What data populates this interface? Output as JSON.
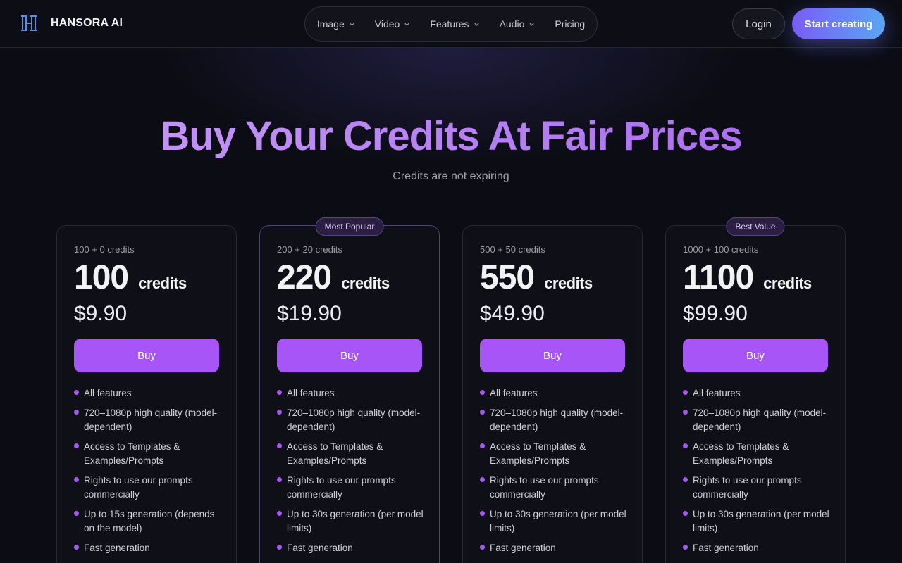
{
  "header": {
    "brand": "HANSORA AI",
    "nav": [
      {
        "label": "Image",
        "dropdown": true
      },
      {
        "label": "Video",
        "dropdown": true
      },
      {
        "label": "Features",
        "dropdown": true
      },
      {
        "label": "Audio",
        "dropdown": true
      },
      {
        "label": "Pricing",
        "dropdown": false
      }
    ],
    "login": "Login",
    "cta": "Start creating"
  },
  "hero": {
    "title": "Buy Your Credits At Fair Prices",
    "subtitle": "Credits are not expiring"
  },
  "plans": [
    {
      "badge": "",
      "sub": "100 + 0 credits",
      "credits": "100",
      "unit": "credits",
      "price": "$9.90",
      "buy": "Buy",
      "features": [
        "All features",
        "720–1080p high quality (model-dependent)",
        "Access to Templates & Examples/Prompts",
        "Rights to use our prompts commercially",
        "Up to 15s generation (depends on the model)",
        "Fast generation"
      ]
    },
    {
      "badge": "Most Popular",
      "sub": "200 + 20 credits",
      "credits": "220",
      "unit": "credits",
      "price": "$19.90",
      "buy": "Buy",
      "features": [
        "All features",
        "720–1080p high quality (model-dependent)",
        "Access to Templates & Examples/Prompts",
        "Rights to use our prompts commercially",
        "Up to 30s generation (per model limits)",
        "Fast generation"
      ]
    },
    {
      "badge": "",
      "sub": "500 + 50 credits",
      "credits": "550",
      "unit": "credits",
      "price": "$49.90",
      "buy": "Buy",
      "features": [
        "All features",
        "720–1080p high quality (model-dependent)",
        "Access to Templates & Examples/Prompts",
        "Rights to use our prompts commercially",
        "Up to 30s generation (per model limits)",
        "Fast generation"
      ]
    },
    {
      "badge": "Best Value",
      "sub": "1000 + 100 credits",
      "credits": "1100",
      "unit": "credits",
      "price": "$99.90",
      "buy": "Buy",
      "features": [
        "All features",
        "720–1080p high quality (model-dependent)",
        "Access to Templates & Examples/Prompts",
        "Rights to use our prompts commercially",
        "Up to 30s generation (per model limits)",
        "Fast generation"
      ]
    }
  ],
  "colors": {
    "accent": "#a855f7",
    "background": "#0b0c14"
  }
}
